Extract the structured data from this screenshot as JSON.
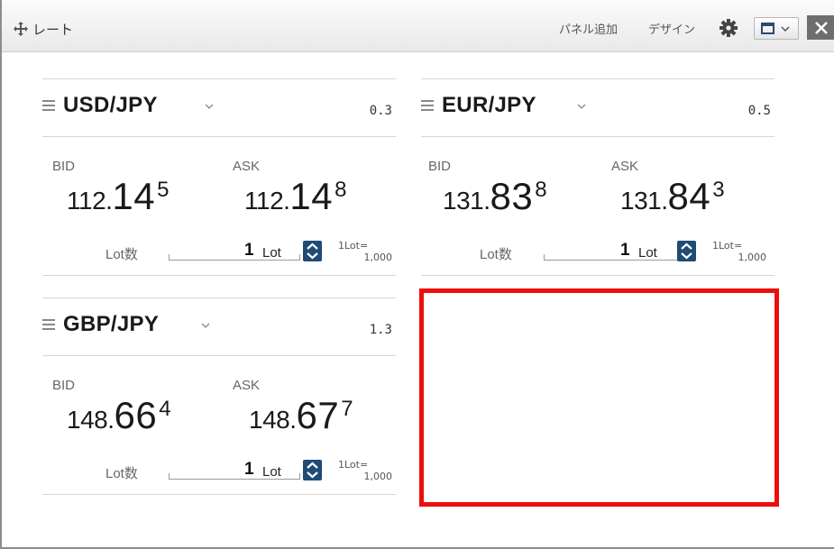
{
  "window": {
    "title": "レート",
    "add_panel_label": "パネル追加",
    "design_label": "デザイン",
    "close_label": "✕"
  },
  "panels": [
    {
      "pair": "USD/JPY",
      "spread": "0.3",
      "bid_label": "BID",
      "ask_label": "ASK",
      "bid": {
        "head": "112.",
        "big": "14",
        "sup": "5"
      },
      "ask": {
        "head": "112.",
        "big": "14",
        "sup": "8"
      },
      "lot_label": "Lot数",
      "lot_value": "1",
      "lot_unit": "Lot",
      "lot_note_line1": "1Lot=",
      "lot_note_line2": "1,000"
    },
    {
      "pair": "EUR/JPY",
      "spread": "0.5",
      "bid_label": "BID",
      "ask_label": "ASK",
      "bid": {
        "head": "131.",
        "big": "83",
        "sup": "8"
      },
      "ask": {
        "head": "131.",
        "big": "84",
        "sup": "3"
      },
      "lot_label": "Lot数",
      "lot_value": "1",
      "lot_unit": "Lot",
      "lot_note_line1": "1Lot=",
      "lot_note_line2": "1,000"
    },
    {
      "pair": "GBP/JPY",
      "spread": "1.3",
      "bid_label": "BID",
      "ask_label": "ASK",
      "bid": {
        "head": "148.",
        "big": "66",
        "sup": "4"
      },
      "ask": {
        "head": "148.",
        "big": "67",
        "sup": "7"
      },
      "lot_label": "Lot数",
      "lot_value": "1",
      "lot_unit": "Lot",
      "lot_note_line1": "1Lot=",
      "lot_note_line2": "1,000"
    }
  ],
  "colors": {
    "accent": "#1f4b75",
    "highlight_border": "#ee0d0d",
    "close_button": "#6e6e6e"
  },
  "icons": [
    "move-icon",
    "gear-icon",
    "layout-icon",
    "chevron-down-icon",
    "close-icon",
    "menu-icon",
    "arrow-up-icon",
    "arrow-down-icon"
  ]
}
